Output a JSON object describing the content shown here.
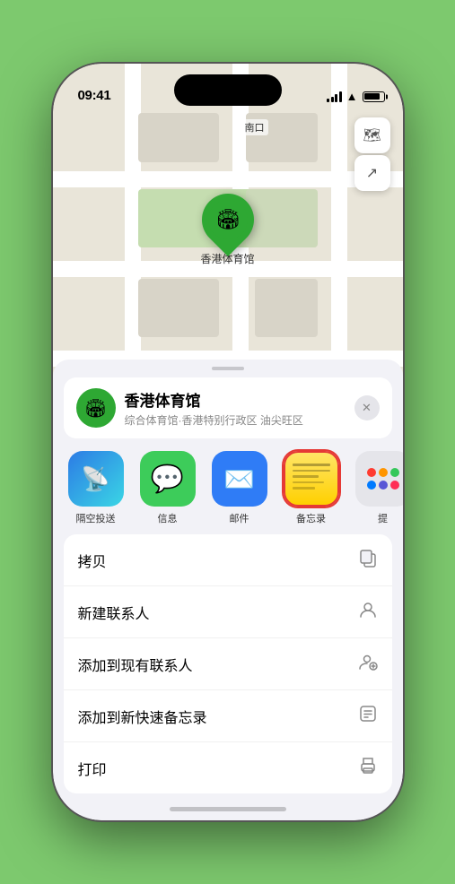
{
  "status": {
    "time": "09:41",
    "location_arrow": "▶"
  },
  "map": {
    "label": "南口",
    "pin_venue": "香港体育馆"
  },
  "location_card": {
    "name": "香港体育馆",
    "subtitle": "综合体育馆·香港特别行政区 油尖旺区",
    "close_label": "✕"
  },
  "share_items": [
    {
      "id": "airdrop",
      "label": "隔空投送",
      "emoji": "📡"
    },
    {
      "id": "messages",
      "label": "信息",
      "emoji": "💬"
    },
    {
      "id": "mail",
      "label": "邮件",
      "emoji": "✉️"
    },
    {
      "id": "notes",
      "label": "备忘录",
      "emoji": ""
    },
    {
      "id": "more",
      "label": "提",
      "emoji": ""
    }
  ],
  "actions": [
    {
      "id": "copy",
      "label": "拷贝",
      "icon": "⎘"
    },
    {
      "id": "new-contact",
      "label": "新建联系人",
      "icon": "👤"
    },
    {
      "id": "add-existing",
      "label": "添加到现有联系人",
      "icon": "👤"
    },
    {
      "id": "add-notes",
      "label": "添加到新快速备忘录",
      "icon": "📋"
    },
    {
      "id": "print",
      "label": "打印",
      "icon": "🖨"
    }
  ]
}
